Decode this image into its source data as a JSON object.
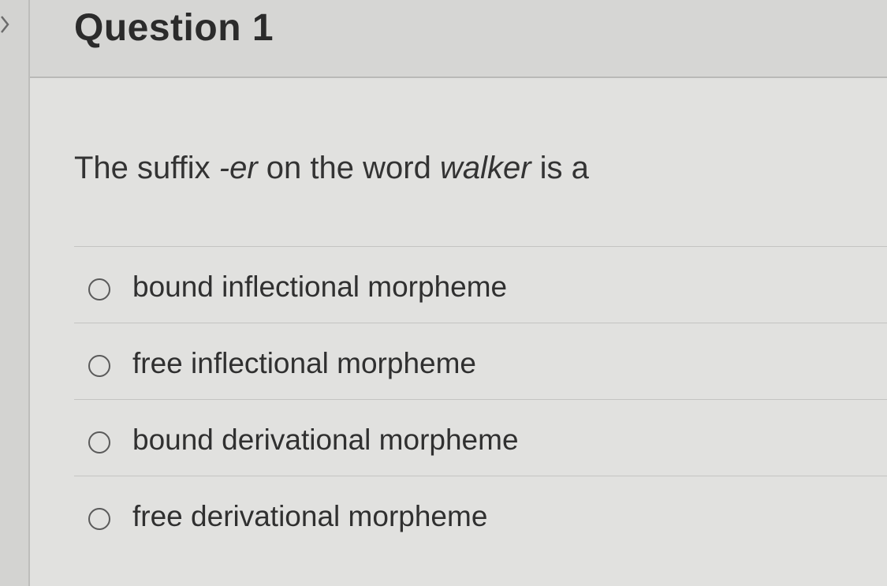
{
  "question": {
    "title": "Question 1",
    "prompt": {
      "part1": "The suffix ",
      "part2": "-er",
      "part3": " on the word ",
      "part4": "walker",
      "part5": " is a"
    },
    "options": [
      {
        "label": "bound inflectional morpheme",
        "selected": false
      },
      {
        "label": "free inflectional morpheme",
        "selected": false
      },
      {
        "label": "bound derivational morpheme",
        "selected": false
      },
      {
        "label": "free derivational morpheme",
        "selected": false
      }
    ]
  },
  "icons": {
    "gutter": "chevron-right-icon",
    "option": "radio-button-icon"
  }
}
